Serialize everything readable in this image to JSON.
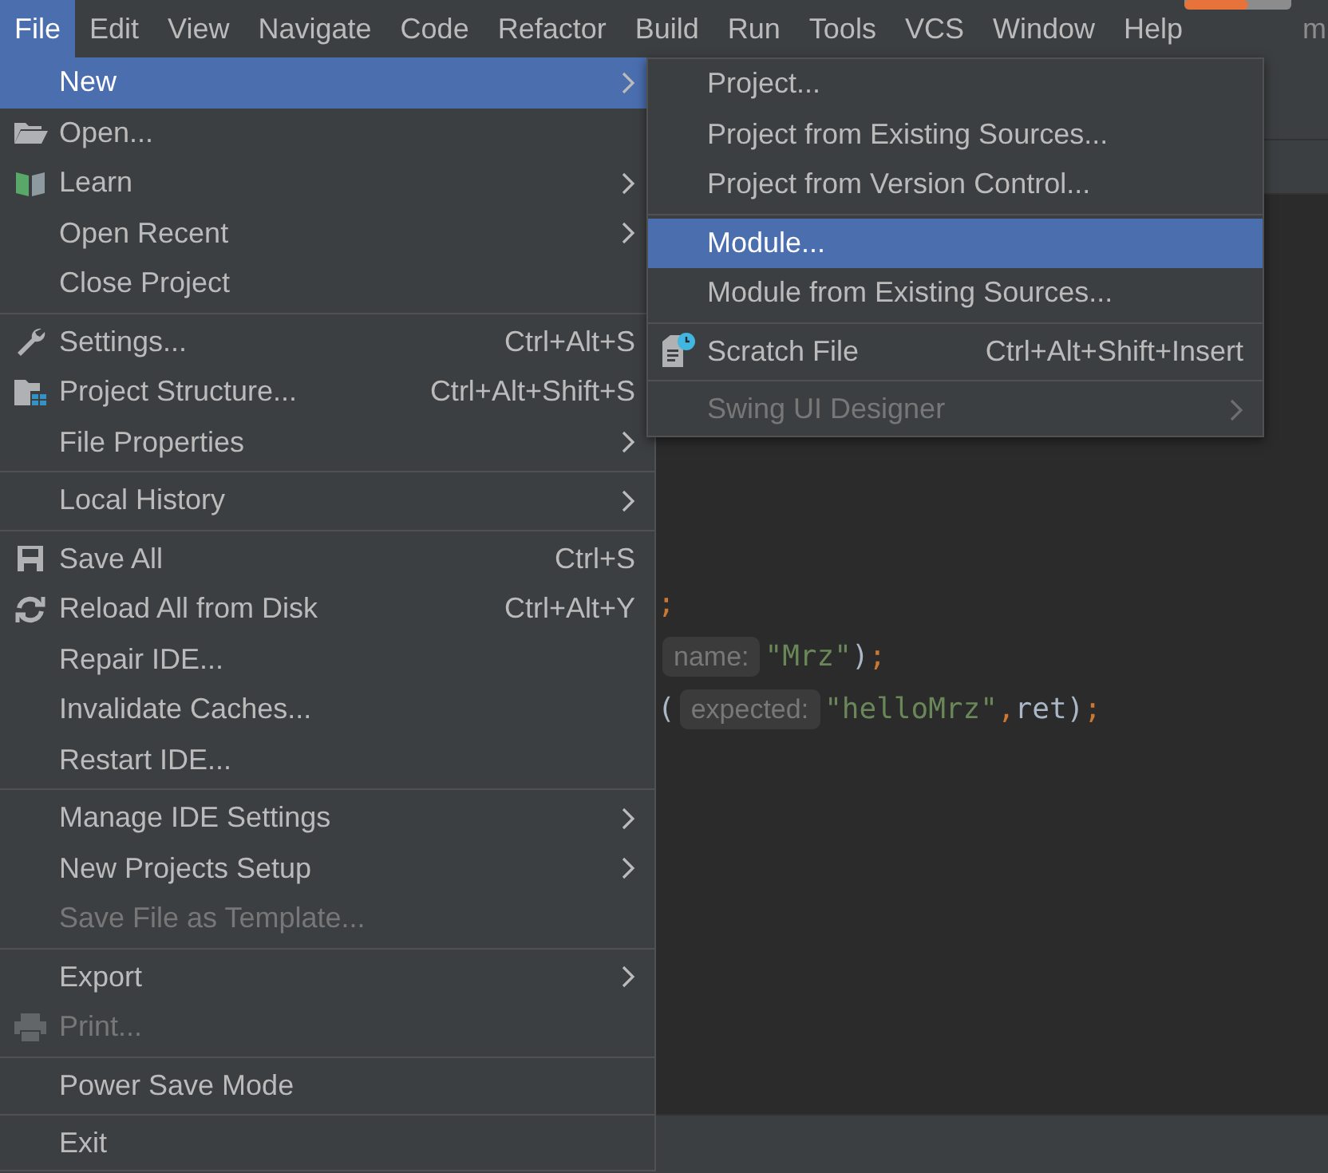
{
  "menubar": [
    {
      "label": "File",
      "selected": true
    },
    {
      "label": "Edit",
      "selected": false
    },
    {
      "label": "View",
      "selected": false
    },
    {
      "label": "Navigate",
      "selected": false
    },
    {
      "label": "Code",
      "selected": false
    },
    {
      "label": "Refactor",
      "selected": false
    },
    {
      "label": "Build",
      "selected": false
    },
    {
      "label": "Run",
      "selected": false
    },
    {
      "label": "Tools",
      "selected": false
    },
    {
      "label": "VCS",
      "selected": false
    },
    {
      "label": "Window",
      "selected": false
    },
    {
      "label": "Help",
      "selected": false
    }
  ],
  "progress": {
    "level": 0.6
  },
  "window_edge_text": "m",
  "file_menu": {
    "groups": [
      [
        {
          "label": "New",
          "selected": true,
          "disabled": false,
          "submenu": true
        },
        {
          "label": "Open...",
          "selected": false,
          "disabled": false,
          "submenu": false
        },
        {
          "label": "Learn",
          "selected": false,
          "disabled": false,
          "submenu": true
        },
        {
          "label": "Open Recent",
          "selected": false,
          "disabled": false,
          "submenu": true
        },
        {
          "label": "Close Project",
          "selected": false,
          "disabled": false,
          "submenu": false
        }
      ],
      [
        {
          "label": "Settings...",
          "shortcut": "Ctrl+Alt+S",
          "selected": false,
          "disabled": false,
          "submenu": false
        },
        {
          "label": "Project Structure...",
          "shortcut": "Ctrl+Alt+Shift+S",
          "selected": false,
          "disabled": false,
          "submenu": false
        },
        {
          "label": "File Properties",
          "selected": false,
          "disabled": false,
          "submenu": true
        }
      ],
      [
        {
          "label": "Local History",
          "selected": false,
          "disabled": false,
          "submenu": true
        }
      ],
      [
        {
          "label": "Save All",
          "shortcut": "Ctrl+S",
          "selected": false,
          "disabled": false,
          "submenu": false
        },
        {
          "label": "Reload All from Disk",
          "shortcut": "Ctrl+Alt+Y",
          "selected": false,
          "disabled": false,
          "submenu": false
        },
        {
          "label": "Repair IDE...",
          "selected": false,
          "disabled": false,
          "submenu": false
        },
        {
          "label": "Invalidate Caches...",
          "selected": false,
          "disabled": false,
          "submenu": false
        },
        {
          "label": "Restart IDE...",
          "selected": false,
          "disabled": false,
          "submenu": false
        }
      ],
      [
        {
          "label": "Manage IDE Settings",
          "selected": false,
          "disabled": false,
          "submenu": true
        },
        {
          "label": "New Projects Setup",
          "selected": false,
          "disabled": false,
          "submenu": true
        },
        {
          "label": "Save File as Template...",
          "selected": false,
          "disabled": true,
          "submenu": false
        }
      ],
      [
        {
          "label": "Export",
          "selected": false,
          "disabled": false,
          "submenu": true
        },
        {
          "label": "Print...",
          "selected": false,
          "disabled": true,
          "submenu": false
        }
      ],
      [
        {
          "label": "Power Save Mode",
          "selected": false,
          "disabled": false,
          "submenu": false
        }
      ],
      [
        {
          "label": "Exit",
          "selected": false,
          "disabled": false,
          "submenu": false
        }
      ]
    ]
  },
  "new_submenu": {
    "groups": [
      [
        {
          "label": "Project...",
          "selected": false,
          "disabled": false,
          "submenu": false
        },
        {
          "label": "Project from Existing Sources...",
          "selected": false,
          "disabled": false,
          "submenu": false
        },
        {
          "label": "Project from Version Control...",
          "selected": false,
          "disabled": false,
          "submenu": false
        }
      ],
      [
        {
          "label": "Module...",
          "selected": true,
          "disabled": false,
          "submenu": false
        },
        {
          "label": "Module from Existing Sources...",
          "selected": false,
          "disabled": false,
          "submenu": false
        }
      ],
      [
        {
          "label": "Scratch File",
          "shortcut": "Ctrl+Alt+Shift+Insert",
          "selected": false,
          "disabled": false,
          "submenu": false
        }
      ],
      [
        {
          "label": "Swing UI Designer",
          "selected": false,
          "disabled": true,
          "submenu": true
        }
      ]
    ]
  },
  "code_lines": [
    [
      {
        "kind": "semicolon",
        "text": ";"
      }
    ],
    [
      {
        "kind": "hint",
        "text": "name:"
      },
      {
        "kind": "string",
        "text": "\"Mrz\""
      },
      {
        "kind": "plain",
        "text": ")"
      },
      {
        "kind": "semicolon",
        "text": ";"
      }
    ],
    [
      {
        "kind": "plain",
        "text": "("
      },
      {
        "kind": "hint",
        "text": "expected:"
      },
      {
        "kind": "string",
        "text": "\"helloMrz\""
      },
      {
        "kind": "semicolon",
        "text": ","
      },
      {
        "kind": "plain",
        "text": "ret)"
      },
      {
        "kind": "semicolon",
        "text": ";"
      }
    ]
  ]
}
